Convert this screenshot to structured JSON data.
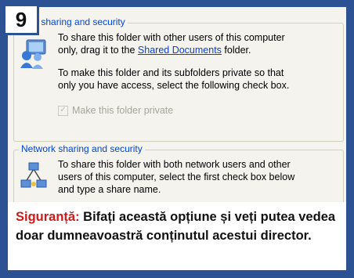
{
  "step_number": "9",
  "local_section": {
    "legend": "Local sharing and security",
    "legend_visible": "ocal sharing and security",
    "line1": "To share this folder with other users of this computer",
    "line2_prefix": "only, drag it to the ",
    "line2_link": "Shared Documents",
    "line2_suffix": " folder.",
    "line3": "To make this folder and its subfolders private so that",
    "line4": "only you have access, select the following check box.",
    "checkbox_label": "Make this folder private",
    "checkbox_checked": true
  },
  "network_section": {
    "legend": "Network sharing and security",
    "line1": "To share this folder with both network users and other",
    "line2": "users of this computer, select the first check box below",
    "line3": "and type a share name."
  },
  "caption": {
    "highlight": "Siguranță:",
    "text": " Bifați această opțiune și veți putea vedea doar dumneavoastră conținutul acestui director."
  },
  "colors": {
    "frame": "#2c5294",
    "legend": "#0046d5",
    "highlight": "#d01919"
  }
}
